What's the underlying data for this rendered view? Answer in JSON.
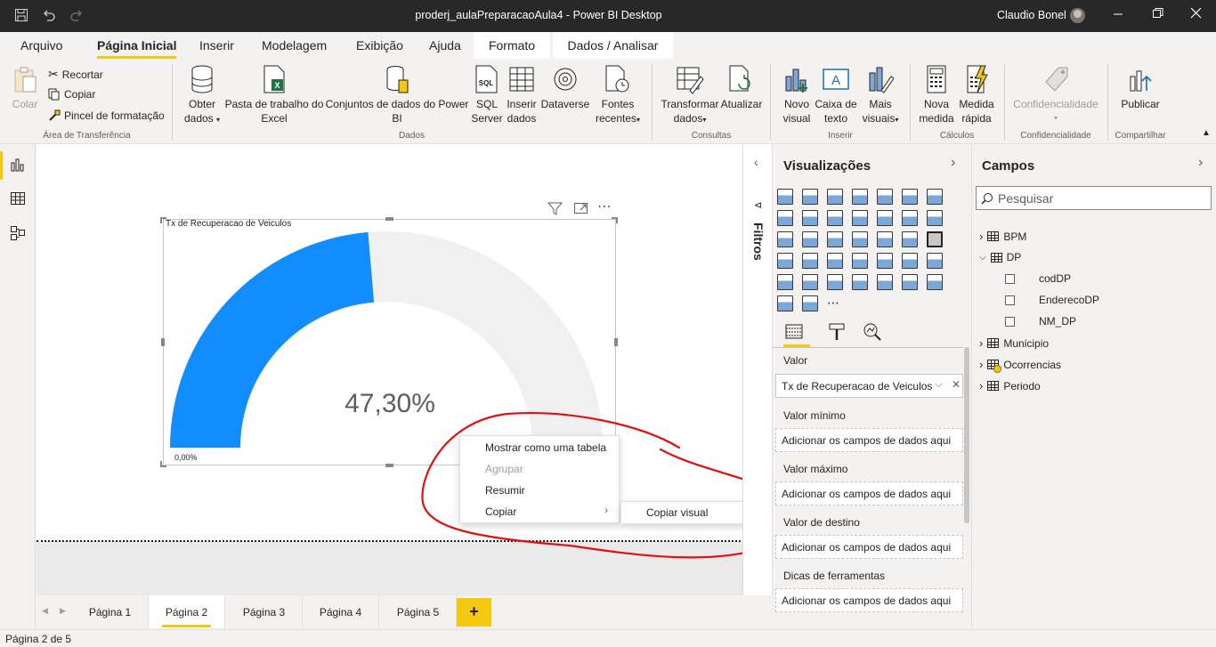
{
  "window": {
    "title": "proderj_aulaPreparacaoAula4 - Power BI Desktop",
    "user": "Claudio Bonel"
  },
  "ribbon_tabs": [
    {
      "label": "Arquivo"
    },
    {
      "label": "Página Inicial"
    },
    {
      "label": "Inserir"
    },
    {
      "label": "Modelagem"
    },
    {
      "label": "Exibição"
    },
    {
      "label": "Ajuda"
    },
    {
      "label": "Formato"
    },
    {
      "label": "Dados / Analisar"
    }
  ],
  "ribbon": {
    "clipboard": {
      "paste": "Colar",
      "cut": "Recortar",
      "copy": "Copiar",
      "format_painter": "Pincel de formatação",
      "group": "Área de Transferência"
    },
    "data": {
      "get_data_1": "Obter",
      "get_data_2": "dados",
      "excel_1": "Pasta de trabalho do",
      "excel_2": "Excel",
      "datasets_1": "Conjuntos de dados do Power",
      "datasets_2": "BI",
      "sql_1": "SQL",
      "sql_2": "Server",
      "enter_1": "Inserir",
      "enter_2": "dados",
      "dataverse": "Dataverse",
      "recent_1": "Fontes",
      "recent_2": "recentes",
      "group": "Dados"
    },
    "queries": {
      "transform_1": "Transformar",
      "transform_2": "dados",
      "refresh": "Atualizar",
      "group": "Consultas"
    },
    "insert": {
      "new_visual_1": "Novo",
      "new_visual_2": "visual",
      "textbox_1": "Caixa de",
      "textbox_2": "texto",
      "more_1": "Mais",
      "more_2": "visuais",
      "group": "Inserir"
    },
    "calc": {
      "measure_1": "Nova",
      "measure_2": "medida",
      "quick_1": "Medida",
      "quick_2": "rápida",
      "group": "Cálculos"
    },
    "sensitivity": {
      "label": "Confidencialidade",
      "group": "Confidencialidade"
    },
    "share": {
      "publish": "Publicar",
      "group": "Compartilhar"
    }
  },
  "visual": {
    "title": "Tx de Recuperacao de Veiculos",
    "value": "47,30%",
    "min_label": "0,00%",
    "gauge_fraction": 0.473,
    "fill_color": "#118dff",
    "track_color": "#f0f0f0"
  },
  "context_menu": {
    "items": [
      {
        "label": "Mostrar como uma tabela",
        "enabled": true
      },
      {
        "label": "Agrupar",
        "enabled": false
      },
      {
        "label": "Resumir",
        "enabled": true
      },
      {
        "label": "Copiar",
        "enabled": true
      }
    ],
    "submenu": {
      "label": "Copiar visual"
    }
  },
  "filters": {
    "label": "Filtros"
  },
  "visualizations": {
    "title": "Visualizações",
    "wells": [
      {
        "label": "Valor",
        "value": "Tx de Recuperacao de Veiculos"
      },
      {
        "label": "Valor mínimo",
        "value": "Adicionar os campos de dados aqui"
      },
      {
        "label": "Valor máximo",
        "value": "Adicionar os campos de dados aqui"
      },
      {
        "label": "Valor de destino",
        "value": "Adicionar os campos de dados aqui"
      },
      {
        "label": "Dicas de ferramentas",
        "value": "Adicionar os campos de dados aqui"
      }
    ]
  },
  "fields": {
    "title": "Campos",
    "search_placeholder": "Pesquisar",
    "tables": [
      {
        "name": "BPM",
        "expanded": false
      },
      {
        "name": "DP",
        "expanded": true,
        "columns": [
          "codDP",
          "EnderecoDP",
          "NM_DP"
        ]
      },
      {
        "name": "Municipio",
        "expanded": false
      },
      {
        "name": "Ocorrencias",
        "expanded": false
      },
      {
        "name": "Periodo",
        "expanded": false
      }
    ]
  },
  "pages": {
    "tabs": [
      "Página 1",
      "Página 2",
      "Página 3",
      "Página 4",
      "Página 5"
    ],
    "active_index": 1,
    "add": "+"
  },
  "status": {
    "text": "Página 2 de 5"
  },
  "colors": {
    "accent": "#f2c811",
    "annotation": "#e01010"
  }
}
